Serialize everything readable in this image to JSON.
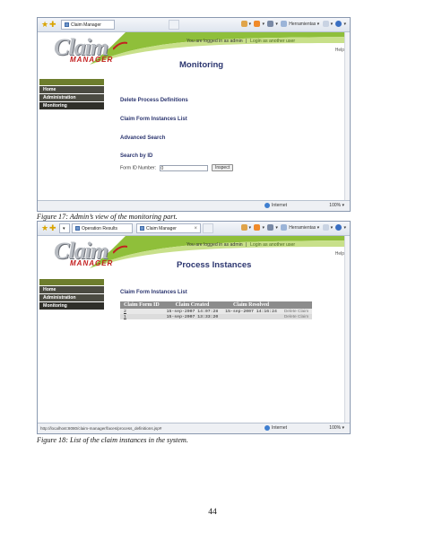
{
  "figure17": {
    "browser": {
      "tab_label": "Claim Manager",
      "tools_label": "Herramientas"
    },
    "app": {
      "logo_word": "Claim",
      "logo_sub": "MANAGER",
      "logged_in_text": "You are logged in as admin",
      "separator": "|",
      "login_other": "Login as another user",
      "help": "Help",
      "sidebar": [
        "Home",
        "Administration",
        "Monitoring"
      ],
      "title": "Monitoring",
      "links": [
        "Delete Process Definitions",
        "Claim Form Instances List",
        "Advanced Search",
        "Search by ID"
      ],
      "form_label": "Form ID Number:",
      "form_value": "0",
      "inspect_button": "Inspect"
    },
    "status": {
      "zone": "Internet",
      "zoom": "100%"
    },
    "caption": "Figure 17: Admin’s view of the monitoring part."
  },
  "figure18": {
    "browser": {
      "tab1_label": "Operation Results",
      "tab2_label": "Claim Manager",
      "tab_close": "×",
      "tools_label": "Herramientas"
    },
    "app": {
      "logo_word": "Claim",
      "logo_sub": "MANAGER",
      "logged_in_text": "You are logged in as admin",
      "separator": "|",
      "login_other": "Login as another user",
      "help": "Help",
      "sidebar": [
        "Home",
        "Administration",
        "Monitoring"
      ],
      "title": "Process Instances",
      "subtitle": "Claim Form Instances List",
      "table": {
        "headers": [
          "Claim Form ID",
          "Claim Created",
          "Claim Resolved",
          ""
        ],
        "rows": [
          {
            "id": "2",
            "created": "15-sep-2007 14:07:28",
            "resolved": "15-sep-2007 14:16:24",
            "action": "Delete Claim"
          },
          {
            "id": "1",
            "created": "15-sep-2007 13:33:20",
            "resolved": "",
            "action": "Delete Claim"
          }
        ]
      }
    },
    "status": {
      "url": "http://localhost:8080/claim-manager/faces/process_definitions.jsp#",
      "zone": "Internet",
      "zoom": "100%"
    },
    "caption": "Figure 18: List of the claim instances in the system."
  },
  "page_number": "44",
  "colors": {
    "swoosh_green": "#8fbf3a",
    "sidebar_dark": "#4b4b42",
    "title_navy": "#2c3670",
    "logo_red": "#c32020"
  },
  "icons": [
    "favorite-star-icon",
    "add-favorite-icon",
    "home-icon",
    "feeds-icon",
    "print-icon",
    "page-icon",
    "tools-icon",
    "help-icon",
    "globe-icon"
  ]
}
